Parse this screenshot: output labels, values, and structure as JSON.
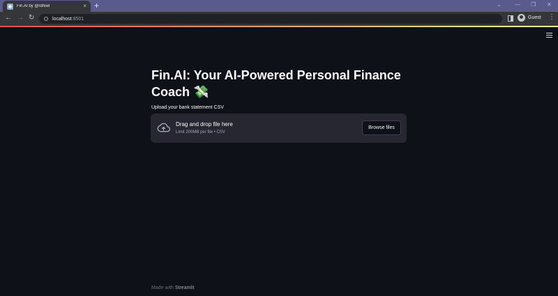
{
  "browser": {
    "tab_title": "Fin.AI by @rdhiwl",
    "tab_close": "×",
    "new_tab": "+",
    "url_host": "localhost",
    "url_port": ":8501",
    "profile_name": "Guest"
  },
  "page": {
    "title": "Fin.AI: Your AI-Powered Personal Finance Coach",
    "title_emoji": "💸",
    "uploader_label": "Upload your bank statement CSV",
    "dropzone_main": "Drag and drop file here",
    "dropzone_sub": "Limit 200MB per file • CSV",
    "browse_button": "Browse files",
    "footer_prefix": "Made with ",
    "footer_brand": "Streamlit"
  },
  "colors": {
    "background": "#0e1117",
    "surface": "#262730",
    "text": "#fafafa",
    "browser_frame": "#5a5a8c"
  }
}
